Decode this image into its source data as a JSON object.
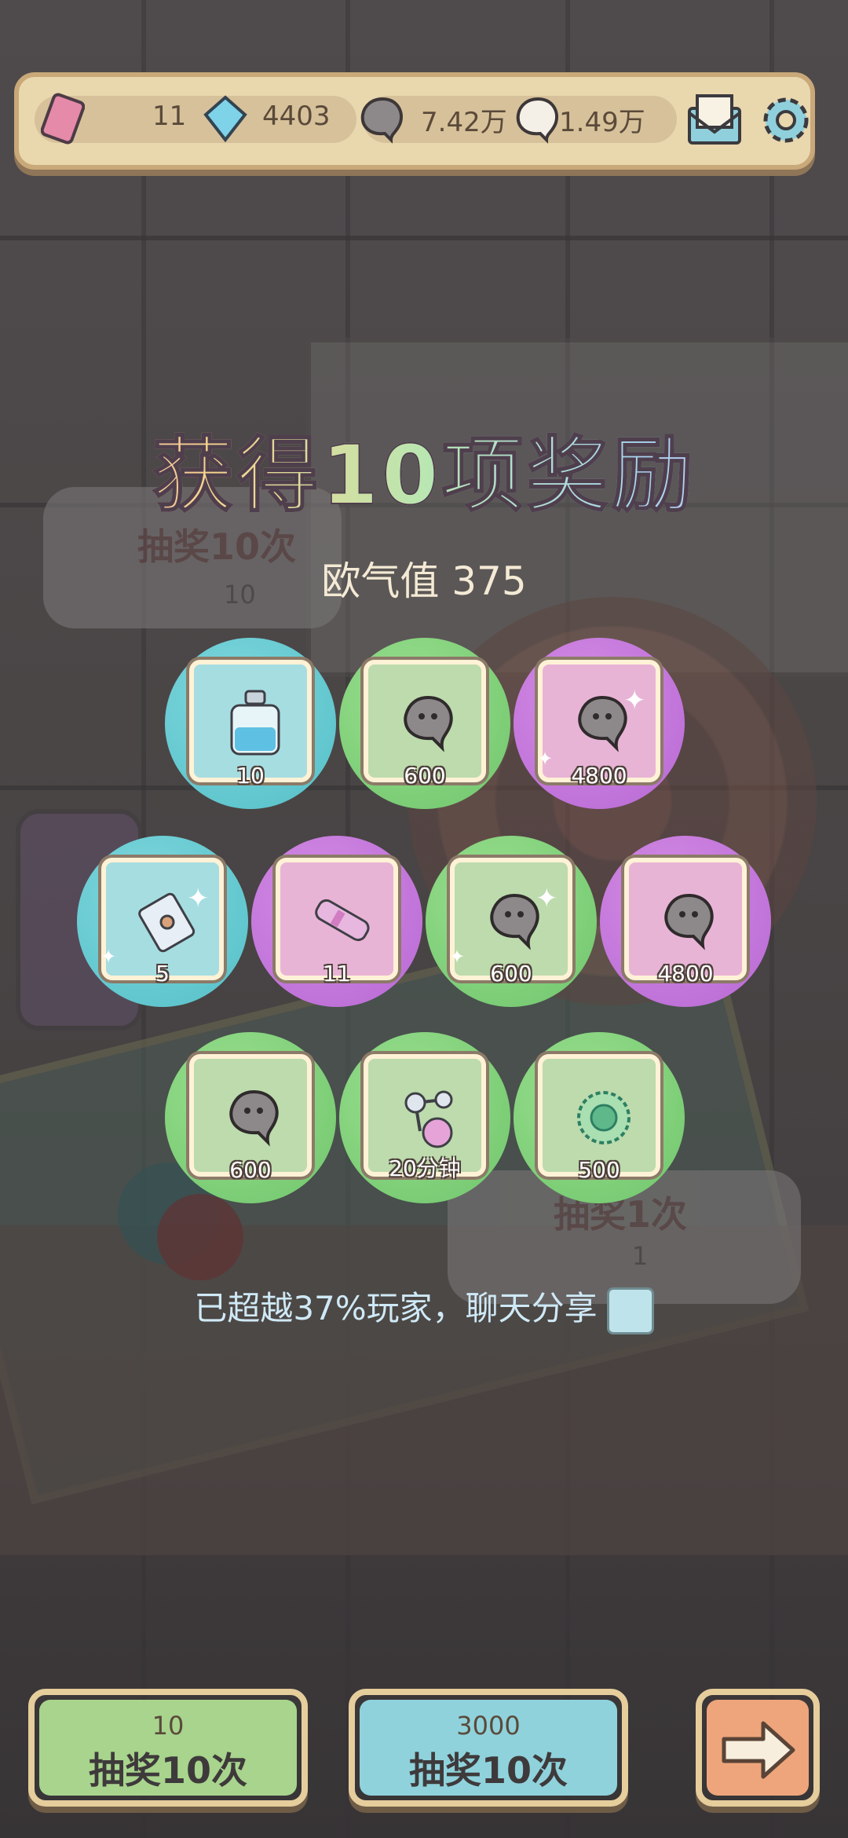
{
  "topbar": {
    "tickets": "11",
    "gems": "4403",
    "gray_blobs": "7.42万",
    "white_blobs": "1.49万"
  },
  "background": {
    "bubble_left_title": "抽奖10次",
    "bubble_left_cost": "10",
    "bubble_right_title": "抽奖1次",
    "bubble_right_cost": "1"
  },
  "title": "获得10项奖励",
  "luck_label": "欧气值 375",
  "rewards": [
    {
      "qty": "10",
      "icon": "potion-bottle-icon",
      "rarity": "blue"
    },
    {
      "qty": "600",
      "icon": "gray-blob-icon",
      "rarity": "green"
    },
    {
      "qty": "4800",
      "icon": "gray-blob-icon",
      "rarity": "purple"
    },
    {
      "qty": "5",
      "icon": "scroll-icon",
      "rarity": "blue"
    },
    {
      "qty": "11",
      "icon": "telescope-icon",
      "rarity": "purple"
    },
    {
      "qty": "600",
      "icon": "gray-blob-icon",
      "rarity": "green"
    },
    {
      "qty": "4800",
      "icon": "gray-blob-icon",
      "rarity": "purple"
    },
    {
      "qty": "600",
      "icon": "gray-blob-icon",
      "rarity": "green"
    },
    {
      "qty": "20分钟",
      "icon": "molecule-flask-icon",
      "rarity": "green"
    },
    {
      "qty": "500",
      "icon": "green-orb-icon",
      "rarity": "green"
    }
  ],
  "share_text": "已超越37%玩家，聊天分享",
  "buttons": {
    "left_cost": "10",
    "left_label": "抽奖10次",
    "middle_cost": "3000",
    "middle_label": "抽奖10次"
  },
  "colors": {
    "blue": "#55bfc8",
    "green": "#6fc56c",
    "purple": "#b768d4",
    "panel": "#e9d7ae"
  }
}
